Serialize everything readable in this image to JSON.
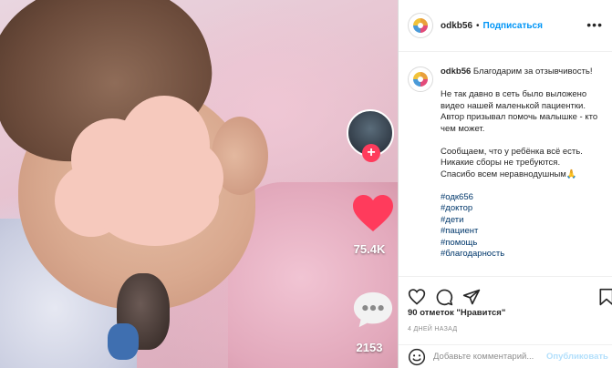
{
  "header": {
    "username": "odkb56",
    "separator": "•",
    "follow_label": "Подписаться",
    "more_label": "•••"
  },
  "caption": {
    "username": "odkb56",
    "lead": "Благодарим за отзывчивость!",
    "paragraph_1": "Не так давно в сеть было выложено видео нашей маленькой пациентки. Автор призывал помочь малышке - кто чем может.",
    "paragraph_2_line_1": "Сообщаем, что у ребёнка всё есть.",
    "paragraph_2_line_2": "Никакие сборы не требуются.",
    "paragraph_2_line_3": "Спасибо всем неравнодушным🙏",
    "hashtags": [
      "#одк656",
      "#доктор",
      "#дети",
      "#пациент",
      "#помощь",
      "#благодарность"
    ]
  },
  "video": {
    "likes": "75.4K",
    "comments": "2153",
    "follow_plus": "+"
  },
  "footer": {
    "likes_count": "90 отметок",
    "likes_suffix": "\"Нравится\"",
    "time_ago": "4 ДНЕЙ НАЗАД",
    "comment_placeholder": "Добавьте комментарий...",
    "post_label": "Опубликовать"
  },
  "colors": {
    "accent": "#0095f6",
    "hashtag": "#00376b",
    "like_heart": "#ff3b5c"
  }
}
